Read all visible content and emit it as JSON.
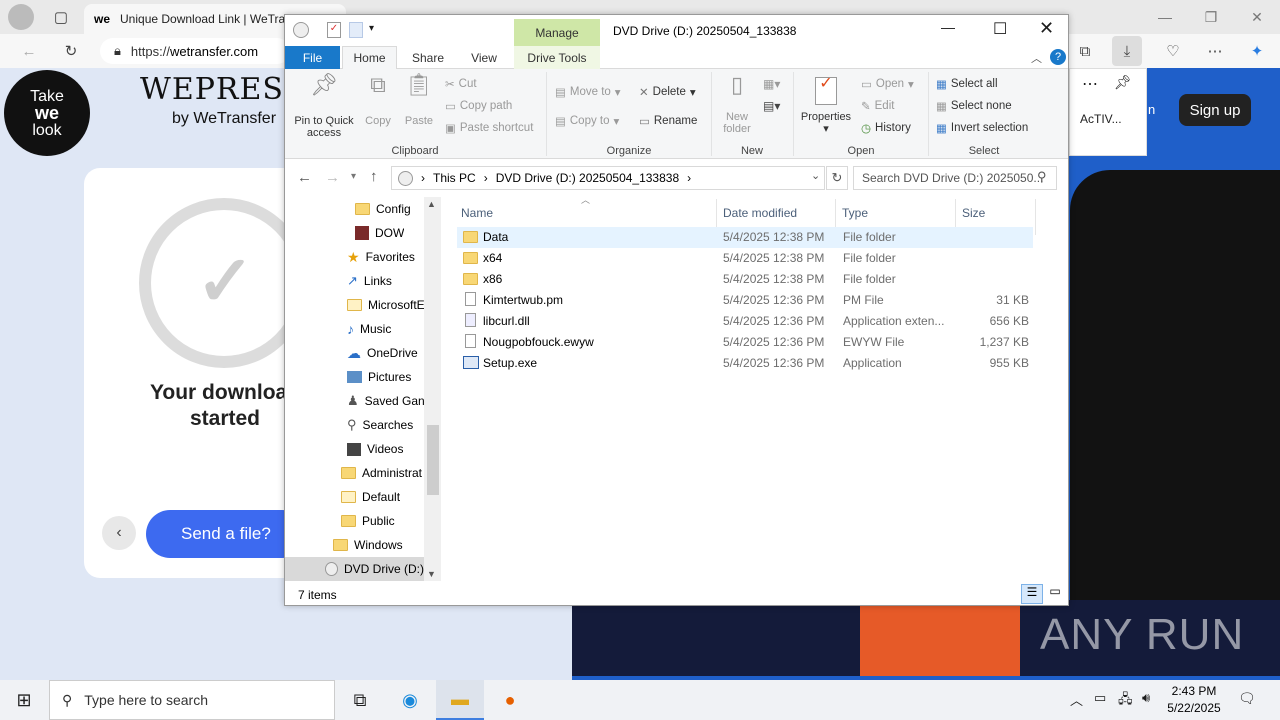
{
  "browser": {
    "tab_favicon": "we",
    "tab_title": "Unique Download Link | WeTra",
    "url_scheme": "https://",
    "url_host": "wetransfer.com",
    "tab_text_extra": "n",
    "tab_text_extra2": "AcTIV..."
  },
  "page": {
    "logo_line1": "Take",
    "logo_line2": "we",
    "logo_line3": "look",
    "brand": "WEPRESENT",
    "brand_sub": "by WeTransfer",
    "download_line1": "Your download",
    "download_line2": "started",
    "send_button": "Send a file?",
    "signup_button": "Sign up",
    "watermark": "ANY RUN"
  },
  "explorer": {
    "title": "DVD Drive (D:) 20250504_133838",
    "contextual_tab_group": "Manage",
    "tabs": [
      "File",
      "Home",
      "Share",
      "View",
      "Drive Tools"
    ],
    "ribbon": {
      "clipboard": {
        "label": "Clipboard",
        "pin": "Pin to Quick access",
        "pin_l1": "Pin to Quick",
        "pin_l2": "access",
        "copy": "Copy",
        "paste": "Paste",
        "cut": "Cut",
        "copy_path": "Copy path",
        "paste_shortcut": "Paste shortcut"
      },
      "organize": {
        "label": "Organize",
        "move_to": "Move to",
        "copy_to": "Copy to",
        "delete": "Delete",
        "rename": "Rename"
      },
      "new": {
        "label": "New",
        "new_folder_l1": "New",
        "new_folder_l2": "folder"
      },
      "open": {
        "label": "Open",
        "properties": "Properties",
        "open": "Open",
        "edit": "Edit",
        "history": "History"
      },
      "select": {
        "label": "Select",
        "select_all": "Select all",
        "select_none": "Select none",
        "invert": "Invert selection"
      }
    },
    "address": {
      "crumb1": "This PC",
      "crumb2": "DVD Drive (D:) 20250504_133838"
    },
    "search_placeholder": "Search DVD Drive (D:) 2025050...",
    "nav": [
      "Config",
      "DOW",
      "Favorites",
      "Links",
      "MicrosoftE",
      "Music",
      "OneDrive",
      "Pictures",
      "Saved Gan",
      "Searches",
      "Videos",
      "Administrat",
      "Default",
      "Public",
      "Windows",
      "DVD Drive (D:)"
    ],
    "columns": [
      "Name",
      "Date modified",
      "Type",
      "Size"
    ],
    "files": [
      {
        "name": "Data",
        "date": "5/4/2025 12:38 PM",
        "type": "File folder",
        "size": "",
        "icon": "folder-icon"
      },
      {
        "name": "x64",
        "date": "5/4/2025 12:38 PM",
        "type": "File folder",
        "size": "",
        "icon": "folder-icon"
      },
      {
        "name": "x86",
        "date": "5/4/2025 12:38 PM",
        "type": "File folder",
        "size": "",
        "icon": "folder-icon"
      },
      {
        "name": "Kimtertwub.pm",
        "date": "5/4/2025 12:36 PM",
        "type": "PM File",
        "size": "31 KB",
        "icon": "file-icon"
      },
      {
        "name": "libcurl.dll",
        "date": "5/4/2025 12:36 PM",
        "type": "Application exten...",
        "size": "656 KB",
        "icon": "dll-icon"
      },
      {
        "name": "Nougpobfouck.ewyw",
        "date": "5/4/2025 12:36 PM",
        "type": "EWYW File",
        "size": "1,237 KB",
        "icon": "file-icon"
      },
      {
        "name": "Setup.exe",
        "date": "5/4/2025 12:36 PM",
        "type": "Application",
        "size": "955 KB",
        "icon": "exe-icon"
      }
    ],
    "status": "7 items"
  },
  "taskbar": {
    "search_placeholder": "Type here to search",
    "time": "2:43 PM",
    "date": "5/22/2025"
  }
}
